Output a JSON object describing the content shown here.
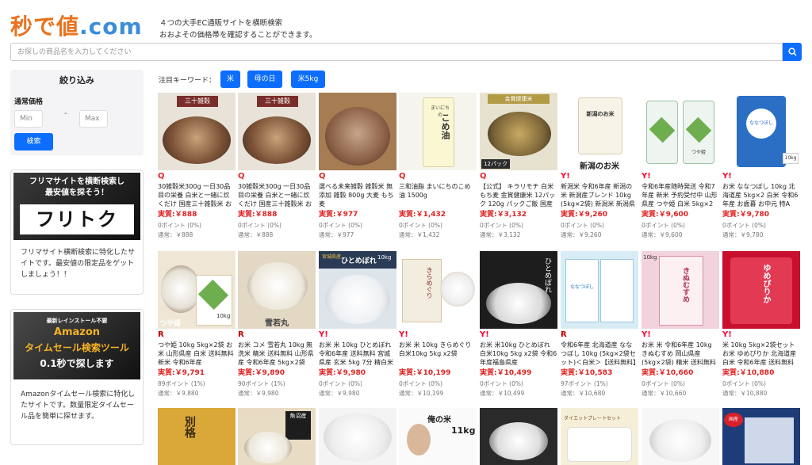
{
  "header": {
    "logo_part1": "秒で値",
    "logo_part2": ".com",
    "tagline1": "４つの大手EC通販サイトを横断検索",
    "tagline2": "おおよその価格帯を確認することができます。"
  },
  "search": {
    "placeholder": "お探しの商品名を入力してください"
  },
  "sidebar": {
    "filter_title": "絞り込み",
    "price_label": "通常価格",
    "min_placeholder": "Min",
    "max_placeholder": "Max",
    "dash": "-",
    "search_button": "検索",
    "promo1": {
      "banner_line1": "フリマサイトを横断検索し",
      "banner_line2": "最安値を探そう！",
      "banner_big": "フリトク",
      "text": "フリマサイト横断検索に特化したサイトです。最安値の限定品をゲットしましょう！！"
    },
    "promo2": {
      "banner_line1": "最新レインストール不要",
      "banner_line2": "Amazon",
      "banner_line3": "タイムセール検索ツール",
      "banner_line4": "0.1秒で探します",
      "text": "Amazonタイムセール検索に特化したサイトです。数量限定タイムセール品を簡単に探せます。"
    }
  },
  "keywords": {
    "label": "注目キーワード：",
    "items": [
      "米",
      "母の日",
      "米5kg"
    ]
  },
  "colors": {
    "accent": "#0d6efd",
    "price": "#e02020",
    "qoo10": "#e8202a",
    "yahoo": "#ff0033",
    "rakuten": "#bf0000"
  },
  "products_row1": [
    {
      "src": "Q",
      "title": "30雑穀米300g 一日30品目の栄養 白米と一緒に炊くだけ 国産三十雑穀米 お米 ご飯 ごはん",
      "price": "実質:￥888",
      "points": "0ポイント (0%)",
      "normal": "通常：￥888"
    },
    {
      "src": "Q",
      "title": "30雑穀米300g 一日30品目の栄養 白米と一緒に炊くだけ 国産三十雑穀米 お米 ご飯 ごはん ピ",
      "price": "実質:￥888",
      "points": "0ポイント (0%)",
      "normal": "通常：￥888"
    },
    {
      "src": "Q",
      "title": "選べる未来雑穀 雑穀米 無添加 雑穀 800g 大麦 もち麦",
      "price": "実質:￥977",
      "points": "0ポイント (0%)",
      "normal": "通常：￥977"
    },
    {
      "src": "Q",
      "title": "三和油脂 まいにちのこめ油 1500g",
      "price": "実質:￥1,432",
      "points": "0ポイント (0%)",
      "normal": "通常：￥1,432"
    },
    {
      "src": "Q",
      "title": "【公式】 キラリモチ 白米 もち麦 金賞健康米 12パック 120g パックご飯 国産米 ごはんパック",
      "price": "実質:￥3,132",
      "points": "0ポイント (0%)",
      "normal": "通常：￥3,132"
    },
    {
      "src": "Y!",
      "title": "新潟米 令和6年産 新潟の米 新潟産ブレンド 10kg (5kg×2袋) 新潟米 新潟県グループ お米",
      "price": "実質:￥9,260",
      "points": "0ポイント (0%)",
      "normal": "通常：￥9,260"
    },
    {
      "src": "Y!",
      "title": "令和6年産随時発送 令和7年産 新米 予約受付中 山形県産 つや姫 白米 5kg×2 送料無料 キキ",
      "price": "実質:￥9,600",
      "points": "0ポイント (0%)",
      "normal": "通常：￥9,600"
    },
    {
      "src": "Y!",
      "title": "お米 ななつぼし 10kg 北海道産 5kg×2 白米 令和6年産 お歳暮 お中元 特A",
      "price": "実質:￥9,780",
      "points": "0ポイント (0%)",
      "normal": "通常：￥9,780"
    }
  ],
  "products_row2": [
    {
      "src": "R",
      "title": "つや姫 10kg 5kg×2袋 お米 山形県産 白米 送料無料 新米 令和6年産",
      "price": "実質:￥9,791",
      "points": "89ポイント (1%)",
      "normal": "通常：￥9,880"
    },
    {
      "src": "R",
      "title": "お米 コメ 雪若丸 10kg 無洗米 精米 送料無料 山形県産 令和6年産 5kg×2袋",
      "price": "実質:￥9,890",
      "points": "90ポイント (1%)",
      "normal": "通常：￥9,980"
    },
    {
      "src": "Y!",
      "title": "お米 米 10kg ひとめぼれ 令和6年産 送料無料 宮城県産 玄米 5kg 7分 精白米 精米時重量1割減",
      "price": "実質:￥9,980",
      "points": "0ポイント (0%)",
      "normal": "通常：￥9,980"
    },
    {
      "src": "Y!",
      "title": "お米 米 10kg きらめぐり 白米10kg 5kg x2袋",
      "price": "実質:￥10,199",
      "points": "0ポイント (0%)",
      "normal": "通常：￥10,199"
    },
    {
      "src": "Y!",
      "title": "お米 米10kg ひとめぼれ 白米10kg 5kg x2袋 令和6年度福島県産",
      "price": "実質:￥10,499",
      "points": "0ポイント (0%)",
      "normal": "通常：￥10,499"
    },
    {
      "src": "R",
      "title": "令和6年産 北海道産 ななつぼし 10kg (5kg×2袋セット)＜白米＞【送料無料】【北海道米 送料無",
      "price": "実質:￥10,583",
      "points": "97ポイント (1%)",
      "normal": "通常：￥10,680"
    },
    {
      "src": "Y!",
      "title": "お米 米 令和6年産 10kg きぬむすめ 岡山県産 (5kg×2袋) 精米 送料無料",
      "price": "実質:￥10,660",
      "points": "0ポイント (0%)",
      "normal": "通常：￥10,660"
    },
    {
      "src": "Y!",
      "title": "米 10kg 5kg×2袋セット お米 ゆめぴりか 北海道産 白米 令和6年産 送料無料",
      "price": "実質:￥10,880",
      "points": "0ポイント (0%)",
      "normal": "通常：￥10,880"
    }
  ],
  "thumb_labels": {
    "r1c1": "三十雑穀",
    "r1c2": "三十雑穀",
    "r1c3": "",
    "r1c4": "こめ油",
    "r1c4_top": "まいにちの",
    "r1c5": "12パック",
    "r1c5_top": "金賞健康米",
    "r1c6": "新潟のお米",
    "r1c6_big": "新潟のお米",
    "r1c7": "つや姫",
    "r1c8": "ななつぼし",
    "r1c8_w": "10kg",
    "r2c1": "つや姫",
    "r2c1_w": "10kg",
    "r2c2": "雪若丸",
    "r2c3": "ひとめぼれ",
    "r2c3_w": "10kg",
    "r2c3_top": "宮城県産",
    "r2c4": "きらめぐり",
    "r2c5": "ひとめぼれ",
    "r2c6": "ななつぼし",
    "r2c7": "きぬむすめ",
    "r2c7_w": "10kg",
    "r2c8": "ゆめぴりか",
    "r3c1": "別格",
    "r3c2": "魚沼産",
    "r3c4": "俺の米",
    "r3c4_w": "11kg",
    "r3c6": "ダイエットプレートセット",
    "r3c8": "国産"
  }
}
